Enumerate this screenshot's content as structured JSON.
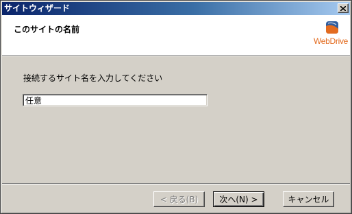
{
  "window": {
    "title": "サイトウィザード"
  },
  "header": {
    "title": "このサイトの名前",
    "logo_text": "WebDrive"
  },
  "form": {
    "label": "接続するサイト名を入力してください",
    "site_name_value": "任意"
  },
  "buttons": {
    "back": "< 戻る(B)",
    "next": "次へ(N) >",
    "cancel": "キャンセル"
  },
  "colors": {
    "titlebar_start": "#0a246a",
    "titlebar_end": "#a6caf0",
    "logo_orange": "#e36b1f",
    "logo_blue": "#2f5d9e"
  }
}
